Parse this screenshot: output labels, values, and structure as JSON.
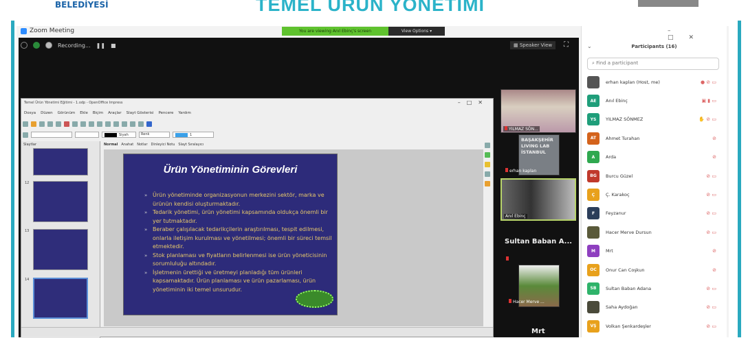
{
  "banner": {
    "org": "BELEDİYESİ",
    "title": "TEMEL ÜRÜN YÖNETİMİ"
  },
  "zoom": {
    "window_title": "Zoom Meeting",
    "viewing": "You are viewing Anıl Ebinç's screen",
    "view_options": "View Options ▾",
    "recording": "Recording...",
    "speaker_view": "Speaker View"
  },
  "impress": {
    "title": "Temel Ürün Yönetimi Eğitimi - 1.odp - OpenOffice Impress",
    "menu": [
      "Dosya",
      "Düzen",
      "Görünüm",
      "Ekle",
      "Biçim",
      "Araçlar",
      "Slayt Gösterisi",
      "Pencere",
      "Yardım"
    ],
    "color_name": "Siyah",
    "fill": "Renk",
    "fill_value": "1",
    "slides_panel": "Slaytlar",
    "thumb_numbers": [
      "",
      "12",
      "13",
      "14"
    ],
    "view_tabs": [
      "Normal",
      "Anahat",
      "Notlar",
      "Dinleyici Notu",
      "Slayt Sıralayıcı"
    ],
    "slide": {
      "title": "Ürün Yönetiminin Görevleri",
      "bullets": [
        "Ürün yönetiminde organizasyonun merkezini sektör, marka ve ürünün kendisi oluşturmaktadır.",
        "Tedarik yönetimi, ürün yönetimi kapsamında oldukça önemli bir yer tutmaktadır.",
        "Beraber çalışılacak tedarikçilerin araştırılması, tespit edilmesi, onlarla iletişim kurulması ve yönetilmesi; önemli bir süreci temsil etmektedir.",
        "Stok planlaması ve fiyatların belirlenmesi ise ürün yöneticisinin sorumluluğu altındadır.",
        "İşletmenin ürettiği ve üretmeyi planladığı tüm ürünleri kapsamaktadır. Ürün planlaması ve ürün pazarlaması, ürün yönetiminin iki temel unsurudur."
      ]
    }
  },
  "video_tiles": [
    {
      "name": "YILMAZ SÖN..."
    },
    {
      "name": "erhan kaplan",
      "logo": "BAŞAKŞEHİR LIVING LAB İSTANBUL"
    },
    {
      "name": "Anıl Ebinç"
    },
    {
      "name": "Sultan Baban A..."
    },
    {
      "name": "Hacer Merve ..."
    },
    {
      "name": "Mrt"
    }
  ],
  "participants": {
    "header": "Participants (16)",
    "search_placeholder": "Find a participant",
    "items": [
      {
        "name": "erhan kaplan (Host, me)",
        "initials": "",
        "color": "#555555",
        "icons": "● ⊘ ▭"
      },
      {
        "name": "Anıl Ebinç",
        "initials": "AE",
        "color": "#1f9e7a",
        "icons": "▣ ▮ ▭"
      },
      {
        "name": "YILMAZ SÖNMEZ",
        "initials": "YS",
        "color": "#1f9e7a",
        "icons": "✋ ⊘ ▭"
      },
      {
        "name": "Ahmet Turahan",
        "initials": "AT",
        "color": "#d4631c",
        "icons": "⊘"
      },
      {
        "name": "Arda",
        "initials": "A",
        "color": "#2fa84f",
        "icons": "⊘"
      },
      {
        "name": "Burcu Güzel",
        "initials": "BG",
        "color": "#c0392b",
        "icons": "⊘ ▭"
      },
      {
        "name": "Ç. Karakoç",
        "initials": "Ç",
        "color": "#e8a11c",
        "icons": "⊘ ▭"
      },
      {
        "name": "Feyzanur",
        "initials": "F",
        "color": "#2c3e5a",
        "icons": "⊘ ▭"
      },
      {
        "name": "Hacer Merve Dursun",
        "initials": "",
        "color": "#5a5a3a",
        "icons": "⊘ ▭"
      },
      {
        "name": "Mrt",
        "initials": "M",
        "color": "#8e3fbf",
        "icons": "⊘"
      },
      {
        "name": "Onur Can Coşkun",
        "initials": "OC",
        "color": "#e8a11c",
        "icons": "⊘"
      },
      {
        "name": "Sultan Baban Adana",
        "initials": "SB",
        "color": "#2fb36a",
        "icons": "⊘ ▭"
      },
      {
        "name": "Saha Aydoğan",
        "initials": "",
        "color": "#4a4a3a",
        "icons": "⊘ ▭"
      },
      {
        "name": "Volkan Şenkardeşler",
        "initials": "VŞ",
        "color": "#e8a11c",
        "icons": "⊘ ▭"
      }
    ]
  }
}
